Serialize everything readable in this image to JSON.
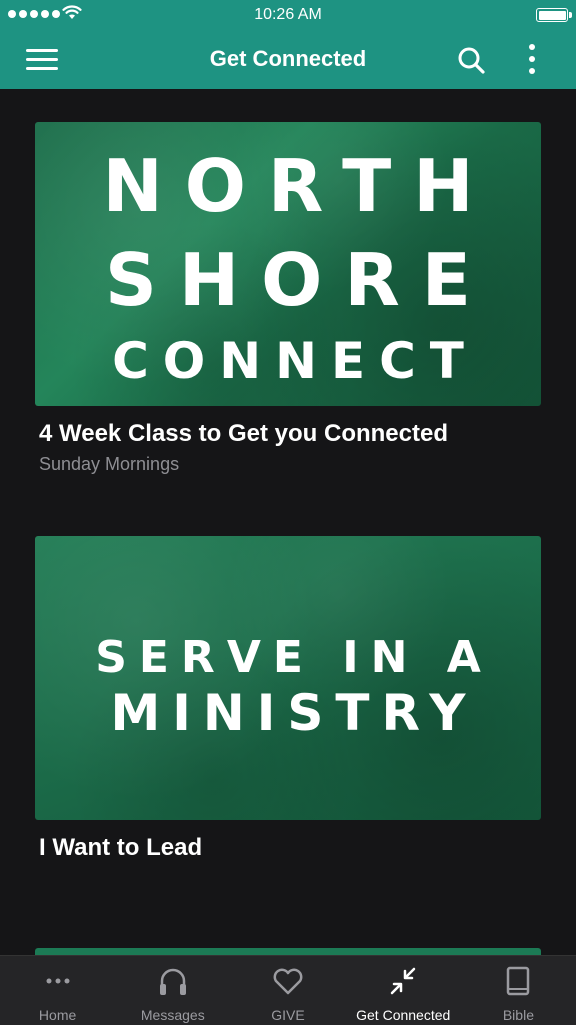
{
  "status_bar": {
    "time": "10:26 AM"
  },
  "nav": {
    "title": "Get Connected"
  },
  "cards": [
    {
      "image_text": [
        "NORTH",
        "SHORE",
        "CONNECT"
      ],
      "title": "4 Week Class to Get you Connected",
      "subtitle": "Sunday Mornings"
    },
    {
      "image_text": [
        "SERVE IN A",
        "MINISTRY"
      ],
      "title": "I Want to Lead"
    }
  ],
  "tabs": [
    {
      "label": "Home",
      "icon": "dots-icon"
    },
    {
      "label": "Messages",
      "icon": "headphones-icon"
    },
    {
      "label": "GIVE",
      "icon": "heart-icon"
    },
    {
      "label": "Get Connected",
      "icon": "arrows-in-icon",
      "active": true
    },
    {
      "label": "Bible",
      "icon": "book-icon"
    }
  ],
  "colors": {
    "accent": "#1e9382",
    "background": "#151517",
    "tab_bar": "#252527",
    "card_green": "#1d6e4b"
  }
}
